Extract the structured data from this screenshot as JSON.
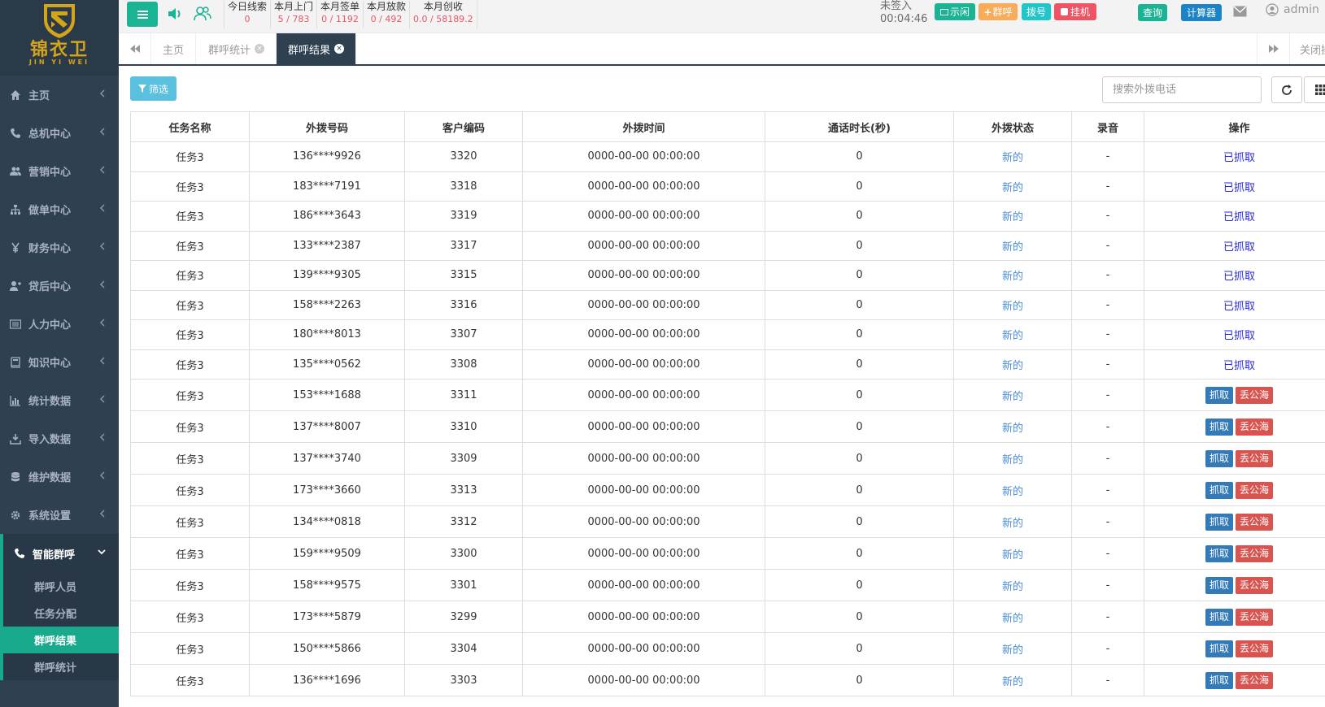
{
  "brand": {
    "cn": "锦衣卫",
    "en": "JIN YI WEI",
    "color": "#d4a41b"
  },
  "sidebar": {
    "items": [
      {
        "label": "主页",
        "icon": "home-icon"
      },
      {
        "label": "总机中心",
        "icon": "phone-volume-icon"
      },
      {
        "label": "营销中心",
        "icon": "users-icon"
      },
      {
        "label": "做单中心",
        "icon": "sitemap-icon"
      },
      {
        "label": "财务中心",
        "icon": "yen-icon"
      },
      {
        "label": "贷后中心",
        "icon": "user-plus-icon"
      },
      {
        "label": "人力中心",
        "icon": "list-alt-icon"
      },
      {
        "label": "知识中心",
        "icon": "book-icon"
      },
      {
        "label": "统计数据",
        "icon": "bar-chart-icon"
      },
      {
        "label": "导入数据",
        "icon": "download-icon"
      },
      {
        "label": "维护数据",
        "icon": "database-icon"
      },
      {
        "label": "系统设置",
        "icon": "gear-icon"
      }
    ],
    "active": {
      "label": "智能群呼",
      "icon": "phone-volume-icon"
    },
    "sub_items": [
      "群呼人员",
      "任务分配",
      "群呼结果",
      "群呼统计"
    ]
  },
  "topbar": {
    "stats": [
      {
        "label": "今日线索",
        "value": "0"
      },
      {
        "label": "本月上门",
        "value": "5 / 783"
      },
      {
        "label": "本月签单",
        "value": "0 / 1192"
      },
      {
        "label": "本月放款",
        "value": "0 / 492"
      },
      {
        "label": "本月创收",
        "value": "0.0 / 58189.2"
      }
    ],
    "sign_status": "未签入",
    "timer": "00:04:46",
    "call_buttons": {
      "idle": "示闲",
      "group_call": "群呼",
      "dial": "拨号",
      "hangup": "挂机"
    },
    "query": "查询",
    "calculator": "计算器",
    "user": "admin"
  },
  "tabs": {
    "items": [
      {
        "label": "主页"
      },
      {
        "label": "群呼统计"
      },
      {
        "label": "群呼结果"
      }
    ],
    "close_ops": "关闭操作"
  },
  "toolbar": {
    "filter": "筛选",
    "search_placeholder": "搜索外拨电话"
  },
  "table": {
    "columns": [
      "任务名称",
      "外拨号码",
      "客户编码",
      "外拨时间",
      "通话时长(秒)",
      "外拨状态",
      "录音",
      "操作"
    ],
    "grabbed_label": "已抓取",
    "grab_label": "抓取",
    "discard_label": "丢公海",
    "rows": [
      {
        "task": "任务3",
        "phone": "136****9926",
        "code": "3320",
        "time": "0000-00-00 00:00:00",
        "duration": "0",
        "status": "新的",
        "record": "-",
        "grabbed": true
      },
      {
        "task": "任务3",
        "phone": "183****7191",
        "code": "3318",
        "time": "0000-00-00 00:00:00",
        "duration": "0",
        "status": "新的",
        "record": "-",
        "grabbed": true
      },
      {
        "task": "任务3",
        "phone": "186****3643",
        "code": "3319",
        "time": "0000-00-00 00:00:00",
        "duration": "0",
        "status": "新的",
        "record": "-",
        "grabbed": true
      },
      {
        "task": "任务3",
        "phone": "133****2387",
        "code": "3317",
        "time": "0000-00-00 00:00:00",
        "duration": "0",
        "status": "新的",
        "record": "-",
        "grabbed": true
      },
      {
        "task": "任务3",
        "phone": "139****9305",
        "code": "3315",
        "time": "0000-00-00 00:00:00",
        "duration": "0",
        "status": "新的",
        "record": "-",
        "grabbed": true
      },
      {
        "task": "任务3",
        "phone": "158****2263",
        "code": "3316",
        "time": "0000-00-00 00:00:00",
        "duration": "0",
        "status": "新的",
        "record": "-",
        "grabbed": true
      },
      {
        "task": "任务3",
        "phone": "180****8013",
        "code": "3307",
        "time": "0000-00-00 00:00:00",
        "duration": "0",
        "status": "新的",
        "record": "-",
        "grabbed": true
      },
      {
        "task": "任务3",
        "phone": "135****0562",
        "code": "3308",
        "time": "0000-00-00 00:00:00",
        "duration": "0",
        "status": "新的",
        "record": "-",
        "grabbed": true
      },
      {
        "task": "任务3",
        "phone": "153****1688",
        "code": "3311",
        "time": "0000-00-00 00:00:00",
        "duration": "0",
        "status": "新的",
        "record": "-",
        "grabbed": false
      },
      {
        "task": "任务3",
        "phone": "137****8007",
        "code": "3310",
        "time": "0000-00-00 00:00:00",
        "duration": "0",
        "status": "新的",
        "record": "-",
        "grabbed": false
      },
      {
        "task": "任务3",
        "phone": "137****3740",
        "code": "3309",
        "time": "0000-00-00 00:00:00",
        "duration": "0",
        "status": "新的",
        "record": "-",
        "grabbed": false
      },
      {
        "task": "任务3",
        "phone": "173****3660",
        "code": "3313",
        "time": "0000-00-00 00:00:00",
        "duration": "0",
        "status": "新的",
        "record": "-",
        "grabbed": false
      },
      {
        "task": "任务3",
        "phone": "134****0818",
        "code": "3312",
        "time": "0000-00-00 00:00:00",
        "duration": "0",
        "status": "新的",
        "record": "-",
        "grabbed": false
      },
      {
        "task": "任务3",
        "phone": "159****9509",
        "code": "3300",
        "time": "0000-00-00 00:00:00",
        "duration": "0",
        "status": "新的",
        "record": "-",
        "grabbed": false
      },
      {
        "task": "任务3",
        "phone": "158****9575",
        "code": "3301",
        "time": "0000-00-00 00:00:00",
        "duration": "0",
        "status": "新的",
        "record": "-",
        "grabbed": false
      },
      {
        "task": "任务3",
        "phone": "173****5879",
        "code": "3299",
        "time": "0000-00-00 00:00:00",
        "duration": "0",
        "status": "新的",
        "record": "-",
        "grabbed": false
      },
      {
        "task": "任务3",
        "phone": "150****5866",
        "code": "3304",
        "time": "0000-00-00 00:00:00",
        "duration": "0",
        "status": "新的",
        "record": "-",
        "grabbed": false
      },
      {
        "task": "任务3",
        "phone": "136****1696",
        "code": "3303",
        "time": "0000-00-00 00:00:00",
        "duration": "0",
        "status": "新的",
        "record": "-",
        "grabbed": false
      }
    ]
  },
  "colors": {
    "primary": "#1ab394",
    "sidebar": "#2f4050",
    "danger": "#ed5565",
    "info": "#5bc0de",
    "link": "#2929d9"
  }
}
